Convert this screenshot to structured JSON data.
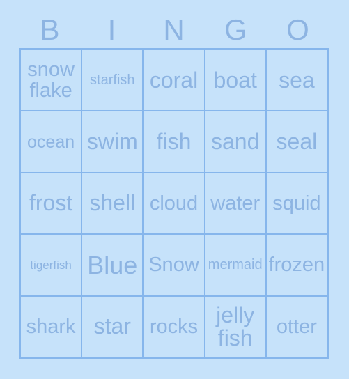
{
  "card": {
    "title": "BINGO",
    "header_letters": [
      "B",
      "I",
      "N",
      "G",
      "O"
    ],
    "colors": {
      "background": "#c6e2fa",
      "cell_fill": "#c6e2fa",
      "grid_line": "#86b6ec",
      "text": "#8db4e2"
    },
    "rows": [
      [
        {
          "text": "snow\nflake",
          "size": "md"
        },
        {
          "text": "starfish",
          "size": "xs"
        },
        {
          "text": "coral",
          "size": "lg"
        },
        {
          "text": "boat",
          "size": "lg"
        },
        {
          "text": "sea",
          "size": "lg"
        }
      ],
      [
        {
          "text": "ocean",
          "size": "sm"
        },
        {
          "text": "swim",
          "size": "lg"
        },
        {
          "text": "fish",
          "size": "lg"
        },
        {
          "text": "sand",
          "size": "lg"
        },
        {
          "text": "seal",
          "size": "lg"
        }
      ],
      [
        {
          "text": "frost",
          "size": "lg"
        },
        {
          "text": "shell",
          "size": "lg"
        },
        {
          "text": "cloud",
          "size": "md"
        },
        {
          "text": "water",
          "size": "md"
        },
        {
          "text": "squid",
          "size": "md"
        }
      ],
      [
        {
          "text": "tigerfish",
          "size": "xxs"
        },
        {
          "text": "Blue",
          "size": "xl"
        },
        {
          "text": "Snow",
          "size": "md"
        },
        {
          "text": "mermaid",
          "size": "xs"
        },
        {
          "text": "frozen",
          "size": "md"
        }
      ],
      [
        {
          "text": "shark",
          "size": "md"
        },
        {
          "text": "star",
          "size": "lg"
        },
        {
          "text": "rocks",
          "size": "md"
        },
        {
          "text": "jelly\nfish",
          "size": "lg"
        },
        {
          "text": "otter",
          "size": "md"
        }
      ]
    ]
  }
}
